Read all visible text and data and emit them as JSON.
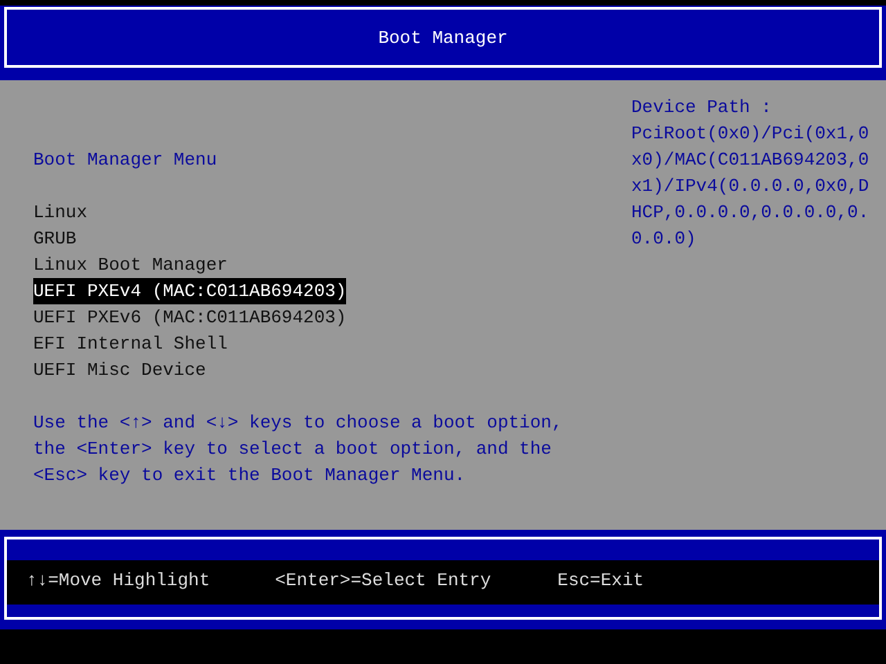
{
  "title": "Boot Manager",
  "menu": {
    "title": "Boot Manager Menu",
    "items": [
      {
        "label": "Linux",
        "selected": false
      },
      {
        "label": "GRUB",
        "selected": false
      },
      {
        "label": "Linux Boot Manager",
        "selected": false
      },
      {
        "label": "UEFI PXEv4 (MAC:C011AB694203)",
        "selected": true
      },
      {
        "label": "UEFI PXEv6 (MAC:C011AB694203)",
        "selected": false
      },
      {
        "label": "EFI Internal Shell",
        "selected": false
      },
      {
        "label": "UEFI Misc Device",
        "selected": false
      }
    ],
    "help_lines": [
      "Use the <↑> and <↓> keys to choose a boot option,",
      "the <Enter> key to select a boot option, and the",
      "<Esc> key to exit the Boot Manager Menu."
    ]
  },
  "device_path": {
    "label": "Device Path :",
    "lines": [
      "PciRoot(0x0)/Pci(0x1,0",
      "x0)/MAC(C011AB694203,0",
      "x1)/IPv4(0.0.0.0,0x0,D",
      "HCP,0.0.0.0,0.0.0.0,0.",
      "0.0.0)"
    ]
  },
  "status_bar": [
    "↑↓=Move Highlight",
    "<Enter>=Select Entry",
    "Esc=Exit"
  ]
}
